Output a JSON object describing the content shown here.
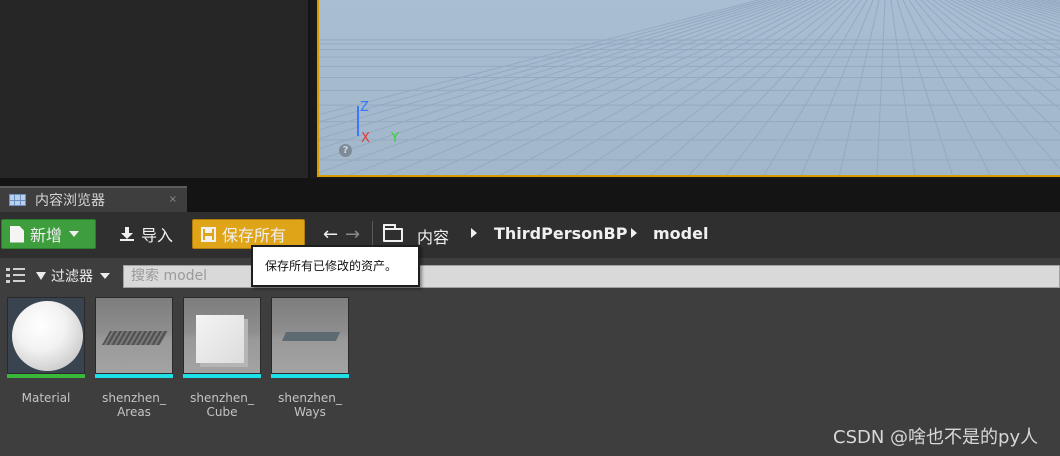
{
  "viewport": {
    "axis_z": "Z",
    "axis_x": "X",
    "axis_y": "Y",
    "help_glyph": "?"
  },
  "tab": {
    "label": "内容浏览器",
    "close_glyph": "×",
    "icon": "content-browser-icon"
  },
  "toolbar": {
    "new_label": "新增",
    "import_label": "导入",
    "save_all_label": "保存所有",
    "back_glyph": "←",
    "forward_glyph": "→",
    "colors": {
      "new": "#3e9e3e",
      "save_all": "#e0a418"
    }
  },
  "breadcrumb": {
    "items": [
      "内容",
      "ThirdPersonBP",
      "model"
    ]
  },
  "filters": {
    "label": "过滤器"
  },
  "search": {
    "placeholder": "搜索 model"
  },
  "tooltip": {
    "text": "保存所有已修改的资产。"
  },
  "assets": [
    {
      "label": "Material",
      "bar_color": "#3ab83a",
      "thumbnail": "sphere"
    },
    {
      "label": "shenzhen_\nAreas",
      "bar_color": "#1ee0e8",
      "thumbnail": "areas"
    },
    {
      "label": "shenzhen_\nCube",
      "bar_color": "#1ee0e8",
      "thumbnail": "cube"
    },
    {
      "label": "shenzhen_\nWays",
      "bar_color": "#1ee0e8",
      "thumbnail": "plane"
    }
  ],
  "watermark": "CSDN @啥也不是的py人"
}
